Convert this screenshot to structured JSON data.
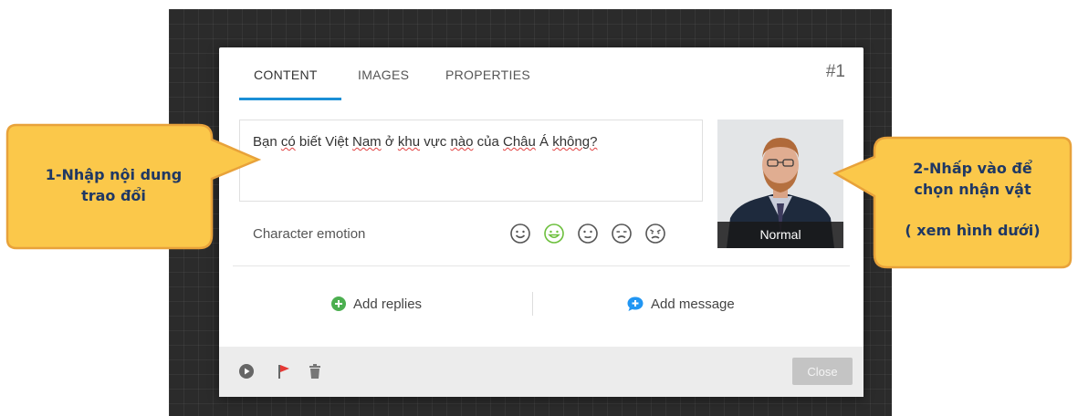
{
  "dialog": {
    "tabs": [
      {
        "label": "CONTENT",
        "active": true
      },
      {
        "label": "IMAGES",
        "active": false
      },
      {
        "label": "PROPERTIES",
        "active": false
      }
    ],
    "number": "#1"
  },
  "content": {
    "text_value": "Bạn có biết Việt Nam ở khu vực nào của Châu Á không?",
    "emotion_label": "Character emotion",
    "emotions": [
      {
        "icon": "smile-face-icon",
        "selected": false
      },
      {
        "icon": "happy-face-icon",
        "selected": true,
        "color": "#6cbf3c"
      },
      {
        "icon": "neutral-face-icon",
        "selected": false
      },
      {
        "icon": "sad-face-icon",
        "selected": false
      },
      {
        "icon": "angry-face-icon",
        "selected": false
      }
    ],
    "character_label": "Normal"
  },
  "actions": {
    "add_replies": "Add replies",
    "add_message": "Add message",
    "add_replies_color": "#4caf50",
    "add_message_color": "#2196f3"
  },
  "footer": {
    "close_label": "Close",
    "icons": [
      "play-icon",
      "flag-icon",
      "trash-icon"
    ],
    "flag_color": "#e53935"
  },
  "callouts": {
    "left_line1": "1-Nhập nội dung",
    "left_line2": "trao đổi",
    "right_line1": "2-Nhấp vào để",
    "right_line2": "chọn nhận vật",
    "right_line3": "( xem hình dưới)",
    "fill_color": "#fbc84a",
    "border_color": "#e8a23a",
    "text_color": "#1f3864"
  }
}
